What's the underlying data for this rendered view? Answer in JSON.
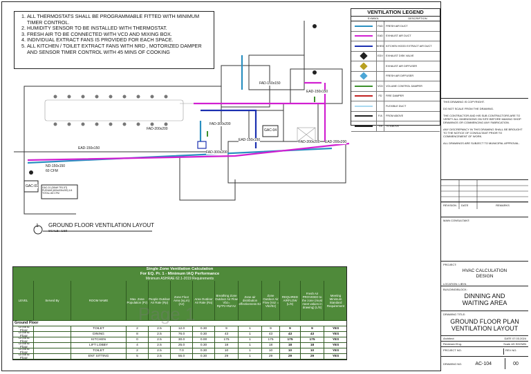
{
  "notes": [
    "ALL THERMOSTATS SHALL BE PROGRAMMABLE FITTED WITH MINIMUM TIMER CONTROL.",
    "HUMIDITY SENSOR TO BE INSTALLED WITH THERMOSTAT.",
    "FRESH AIR TO BE CONNECTED WITH VCD AND MIXING BOX.",
    "INDIVIDUAL EXTRACT FANS IS PROVIDED FOR EACH SPACE.",
    "ALL KITCHEN / TOILET EXTRACT FANS WITH NRD , MOTORIZED DAMPER AND SENSOR TIMER CONTROL WITH 45 MINS OF COOKING"
  ],
  "legend": {
    "title": "VENTILATION LEGEND",
    "col_symbol": "SYMBOL",
    "col_desc": "DESCRIPTION",
    "rows": [
      {
        "abbr": "FAD",
        "desc": "FRESH AIR DUCT",
        "color": "#2a8fc0"
      },
      {
        "abbr": "EAD",
        "desc": "EXHAUST AIR DUCT",
        "color": "#d11fd1"
      },
      {
        "abbr": "KHED",
        "desc": "KITCHEN HOOD EXTRACT AIR DUCT",
        "color": "#1a2fb0"
      },
      {
        "abbr": "EDV",
        "desc": "EXHAUST DISK VALVE",
        "color": "#222222"
      },
      {
        "abbr": "",
        "desc": "EXHAUST AIR DIFFUSER",
        "color": "#b8a020"
      },
      {
        "abbr": "",
        "desc": "FRESH AIR DIFFUSER",
        "color": "#4da6d6"
      },
      {
        "abbr": "VCD",
        "desc": "VOLUME CONTROL DAMPER",
        "color": "#3b8f2a"
      },
      {
        "abbr": "FD",
        "desc": "FIRE DAMPER",
        "color": "#c02020"
      },
      {
        "abbr": "",
        "desc": "FLEXIBLE DUCT",
        "color": "#a8d8f0"
      },
      {
        "abbr": "F/A",
        "desc": "FROM ABOVE",
        "color": "#222222"
      },
      {
        "abbr": "T/A",
        "desc": "TO ABOVE",
        "color": "#222222"
      }
    ]
  },
  "plan": {
    "title": "GROUND FLOOR VENTILATION LAYOUT",
    "number": "1",
    "scale": "SCALE : 1:50",
    "labels": {
      "fad_top": "FAD-150x150",
      "ead_right": "EAD-150x150",
      "fad_200_left": "FAD-200x200",
      "fad_300": "FAD-300x200",
      "ead_left": "EAD-150x150",
      "fad_mid": "FAD-300x200",
      "ead_mid": "EAD-150x150",
      "fad_right1": "FAD-200x200",
      "fad_right2": "EAD-200x200",
      "gac01": "GAC-01",
      "gac04": "GAC-04",
      "cfm_left": "ND-150x150",
      "cfm_left2": "60 CFM",
      "gac_note": "GAC-01 (30kW TR1.5T) PLENUM (600x200x200) 1/4 TOTAL=60 CFM"
    }
  },
  "title_block": {
    "copyright": "THIS DRAWING IS COPYRIGHT.",
    "no_scale": "DO NOT SCALE FROM THE DRAWING.",
    "verify": "THE CONTRACTOR AND HIS SUB CONTRACTORS ARE TO VERIFY ALL DIMENSIONS ON SITE BEFORE MAKING SHOP DRAWINGS OR COMMENCING ANY FABRICATION.",
    "discrepancy": "ANY DISCREPANCY IN THIS DRAWING SHALL BE BROUGHT TO THE NOTICE OF CONSULTANT PRIOR TO COMMENCEMENT OF WORK.",
    "approval": "ALL DRAWINGS ARE SUBJECT TO MUNICIPAL APPROVAL.",
    "revision": "REVISION",
    "date": "DATE",
    "remarks": "REMARKS",
    "main_consultant": "MAIN CONSULTANT:",
    "project_label": "PROJECT:",
    "project": "HVAC CALCULATION DESIGN",
    "location": "LOCATION: LIBYA",
    "building_label": "BUILDING/BLOCK:",
    "building": "DINNING AND WAITING AREA",
    "drawing_title_label": "DRAWING TITLE:",
    "drawing_title": "GROUND FLOOR PLAN VENTILATION LAYOUT",
    "architect": "Architect",
    "date_label": "DATE",
    "date_value": "07.03.2024",
    "reviewed": "Reviewed Eng.",
    "scale_label": "Scale",
    "scale_value": "AS SHOWN",
    "project_no": "PROJECT NO.",
    "rev_no": "REV NO.",
    "drawing_no_label": "DRAWING NO.",
    "drawing_no": "AC-104",
    "rev_value": "00"
  },
  "table": {
    "title1": "Single Zone Ventilation Calculation",
    "title2": "For EQ. Pr. 1 - Minimum IAQ Performance",
    "title3": "Minimum ASHRAE 62.1-2019 Requirements",
    "headers": [
      "LEVEL",
      "Served By",
      "ROOM NAME",
      "Max. Zone Population (Pz)",
      "People Outdoor Air Rate (Rp)",
      "Zone Floor Area (sq.m) (Az)",
      "Area Outdoor Air Rate (Ra)",
      "Breathing Zone Outdoor Air Flow Vbz= Rp*Pz+Ra*Az",
      "Zone air distribution effectiveness Ez",
      "Zone Outdoor Air Flow (Voz = Vbz/Ez)",
      "REQUIRED AIRFLOW (L/S)",
      "Fresh Air PROVIDED to the zone (must meet values in drawing) (L/S)",
      "Meeting Minimum Standard Requirement"
    ],
    "section": "Ground Floor",
    "rows": [
      [
        "Ground Floor",
        "",
        "TOILET",
        "2",
        "2.5",
        "12.0",
        "0.30",
        "9",
        "1",
        "9",
        "9",
        "9",
        "YES"
      ],
      [
        "Ground Floor",
        "",
        "DINING",
        "8",
        "2.5",
        "76.0",
        "0.30",
        "43",
        "1",
        "43",
        "43",
        "43",
        "YES"
      ],
      [
        "Ground Floor",
        "",
        "KITCHEN",
        "0",
        "2.5",
        "30.0",
        "0.00",
        "175",
        "1",
        "175",
        "175",
        "175",
        "YES"
      ],
      [
        "Ground Floor",
        "",
        "LIFT LOBBY",
        "4",
        "2.5",
        "25.0",
        "0.30",
        "18",
        "1",
        "18",
        "18",
        "18",
        "YES"
      ],
      [
        "Ground Floor",
        "",
        "TOILET",
        "2",
        "2.5",
        "7.0",
        "0.30",
        "10",
        "1",
        "10",
        "10",
        "10",
        "YES"
      ],
      [
        "Ground Floor",
        "",
        "ENT SITTING",
        "5",
        "2.5",
        "55.0",
        "0.30",
        "29",
        "1",
        "29",
        "29",
        "29",
        "YES"
      ]
    ],
    "watermark": "Page 1"
  }
}
